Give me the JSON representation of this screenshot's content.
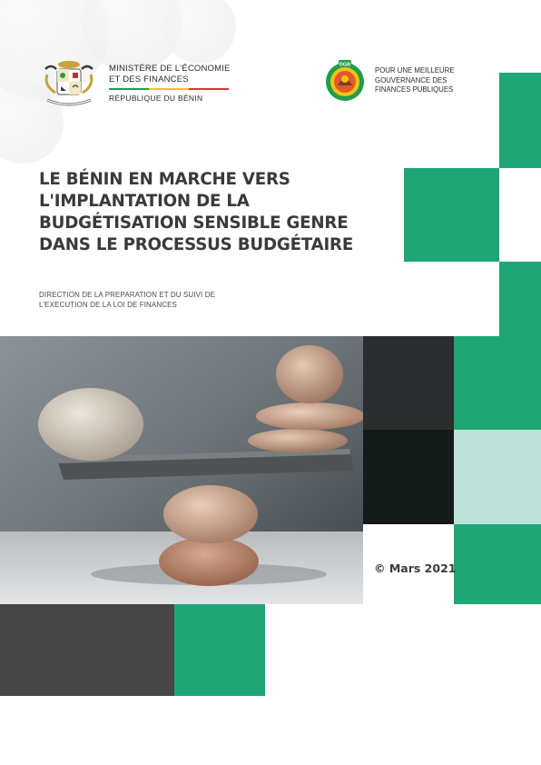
{
  "header": {
    "ministry_line1": "MINISTÈRE DE L'ÉCONOMIE",
    "ministry_line2": "ET DES FINANCES",
    "ministry_line3": "RÉPUBLIQUE DU BÉNIN",
    "slogan_line1": "POUR UNE MEILLEURE",
    "slogan_line2": "GOUVERNANCE DES",
    "slogan_line3": "FINANCES PUBLIQUES",
    "dgb_logo_text": "DGB",
    "coat_of_arms_icon": "benin-coat-of-arms-icon",
    "dgb_logo_icon": "dgb-emblem-icon"
  },
  "title": {
    "line1": "LE BÉNIN EN MARCHE VERS",
    "line2": "L'IMPLANTATION DE LA",
    "line3": "BUDGÉTISATION SENSIBLE GENRE",
    "line4": "DANS LE PROCESSUS BUDGÉTAIRE"
  },
  "subtitle": {
    "line1": "DIRECTION DE LA PREPARATION ET DU SUIVI DE",
    "line2": "L'EXECUTION DE LA LOI DE FINANCES"
  },
  "date": "© Mars 2021",
  "colors": {
    "green": "#1ea674",
    "pale_green": "#bfe3d8",
    "dark_gray": "#464646",
    "title_gray": "#3a3a3a",
    "flag_green": "#1e9e4a",
    "flag_yellow": "#f2c318",
    "flag_red": "#e03131"
  },
  "photo": {
    "subject": "balanced-stones-photo"
  }
}
